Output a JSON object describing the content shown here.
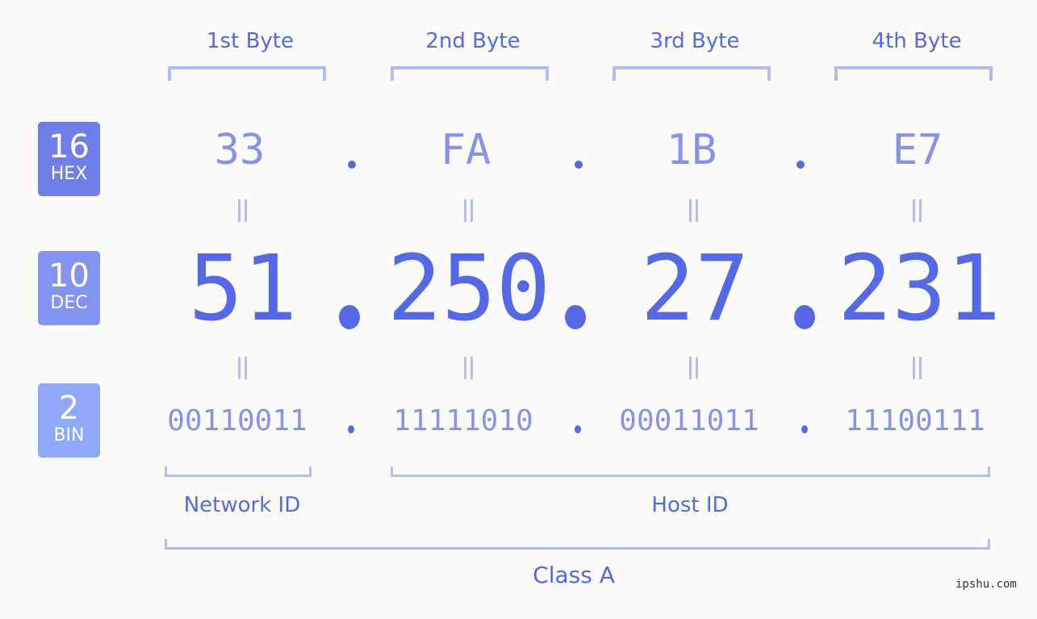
{
  "bases": [
    {
      "num": "16",
      "label": "HEX",
      "color": "#717ee9"
    },
    {
      "num": "10",
      "label": "DEC",
      "color": "#8493f2"
    },
    {
      "num": "2",
      "label": "BIN",
      "color": "#8fa8fb"
    }
  ],
  "byte_labels": [
    "1st Byte",
    "2nd Byte",
    "3rd Byte",
    "4th Byte"
  ],
  "hex": [
    "33",
    "FA",
    "1B",
    "E7"
  ],
  "dec": [
    "51",
    "250",
    "27",
    "231"
  ],
  "bin": [
    "00110011",
    "11111010",
    "00011011",
    "11100111"
  ],
  "network_id_label": "Network ID",
  "host_id_label": "Host ID",
  "class_label": "Class A",
  "watermark": "ipshu.com",
  "colors": {
    "primary": "#5468e8",
    "muted": "#8892ee",
    "bracket": "#b4bdf7",
    "background": "#fbfcfb"
  }
}
